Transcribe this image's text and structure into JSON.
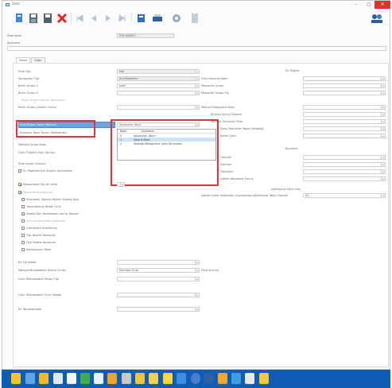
{
  "window": {
    "title": "Stok",
    "min_label": "–",
    "max_label": "▢",
    "close_label": "✕"
  },
  "header": {
    "stok_kodu_label": "Stok Kodu",
    "stok_kodu_value": "STK 000001",
    "aciklama_label": "Açıklama"
  },
  "tabs": [
    "Genel",
    "Diğer"
  ],
  "left": {
    "rows": [
      {
        "label": "Stok Tipi",
        "value": "Mal"
      },
      {
        "label": "Varsayılan Tipi",
        "value": "Ara Mamülleri"
      },
      {
        "label": "Birim Grubu 1",
        "value": "Adet"
      },
      {
        "label": "Birim Grubu 2",
        "value": ""
      },
      {
        "label": "Birim Grubu Çevrim Katsayıları",
        "value": ""
      },
      {
        "label": "Birim Grubu Çevrim Grubu",
        "value": ""
      },
      {
        "label": "Stok Rotası Tanıtı Yöntemi",
        "value": "Varsayılan Tanıtı"
      },
      {
        "label": "Standart Rota Tanımı Sözleşmesi",
        "value": ""
      },
      {
        "label": "Maliyet Grubu Kodu",
        "value": ""
      },
      {
        "label": "Ürün Tüketim Plan Sorusu",
        "value": ""
      },
      {
        "label": "Stok Analiz Zamanı",
        "value": ""
      }
    ],
    "checks": [
      {
        "label": "Su Maddesi İçin Sipariş Verilebilsin",
        "on": false
      },
      {
        "label": "Malzemede Sürüm Artık",
        "on": true
      },
      {
        "label": "Malzeme Kullanımda",
        "on": true
      },
      {
        "label": "Ekonomik Sipariş Miktarı Sipariş Ayar",
        "on": false
      },
      {
        "label": "Tanımlanmış Yedek Ürün",
        "on": false
      },
      {
        "label": "Stokta Son Hareketten Sonra Taşındı",
        "on": false
      },
      {
        "label": "Son Sıralamadaki Aşamalar",
        "on": false
      },
      {
        "label": "Üretimden Kaldırılmış",
        "on": false
      },
      {
        "label": "Tüp Tabela Yapılacak",
        "on": false
      },
      {
        "label": "Fişli Tabela Yapılacak",
        "on": false
      },
      {
        "label": "Kalibrasyon Takip",
        "on": false
      }
    ],
    "bottom_rows": [
      {
        "label": "Ek Tip Adedi",
        "value": ""
      },
      {
        "label": "Maliyet Muhasebesi Hesap Grubu",
        "value": "Standart Grup"
      },
      {
        "label": "Ürün Muhasebesi Hesap Tipi",
        "value": ""
      },
      {
        "label": "Ürün Muhasebesi Ürün Hesabı",
        "value": ""
      },
      {
        "label": "Ek Tanımlamalar",
        "value": ""
      }
    ],
    "fiyat_label": "Fiyat Durum"
  },
  "popup": {
    "headers": [
      "Kodu",
      "Açıklama"
    ],
    "rows": [
      {
        "code": "0",
        "desc": "Varsayılan Tanıtı"
      },
      {
        "code": "1",
        "desc": "Sipariş Bazlı"
      },
      {
        "code": "2",
        "desc": "Stoktaki Bileşenlere Göre Tanımlanır"
      }
    ]
  },
  "right": {
    "title1": "Ek Bilgiler",
    "rows1": [
      {
        "label": "Ürün Sekansı Kodu"
      },
      {
        "label": "Malzeme Grubu"
      },
      {
        "label": "Malzeme Grubu Tip"
      }
    ],
    "rows2": [
      {
        "label": "Maliyet Kategorisi Kodu"
      },
      {
        "label": "Birimin Sonuç Dönem"
      },
      {
        "label": "Yayınlar Sonuçlar Süre"
      },
      {
        "label": "Satış Yatırımlar Yapısı Sahipliği"
      },
      {
        "label": "Kalite Zonu"
      }
    ],
    "title2": "Boyutlar",
    "rows3": [
      {
        "label": "Genişlik"
      },
      {
        "label": "Derinlik"
      },
      {
        "label": "Yükseklik"
      },
      {
        "label": "Ağırlık Yakalama Sonuç"
      }
    ],
    "title3": "Ağırlıklara Göre Giriş",
    "stage_label": "Ağırlık Kalite Sistemleri Uygulaması Ağırlıklarla Tablo Tipinde",
    "stage_value": "01"
  }
}
